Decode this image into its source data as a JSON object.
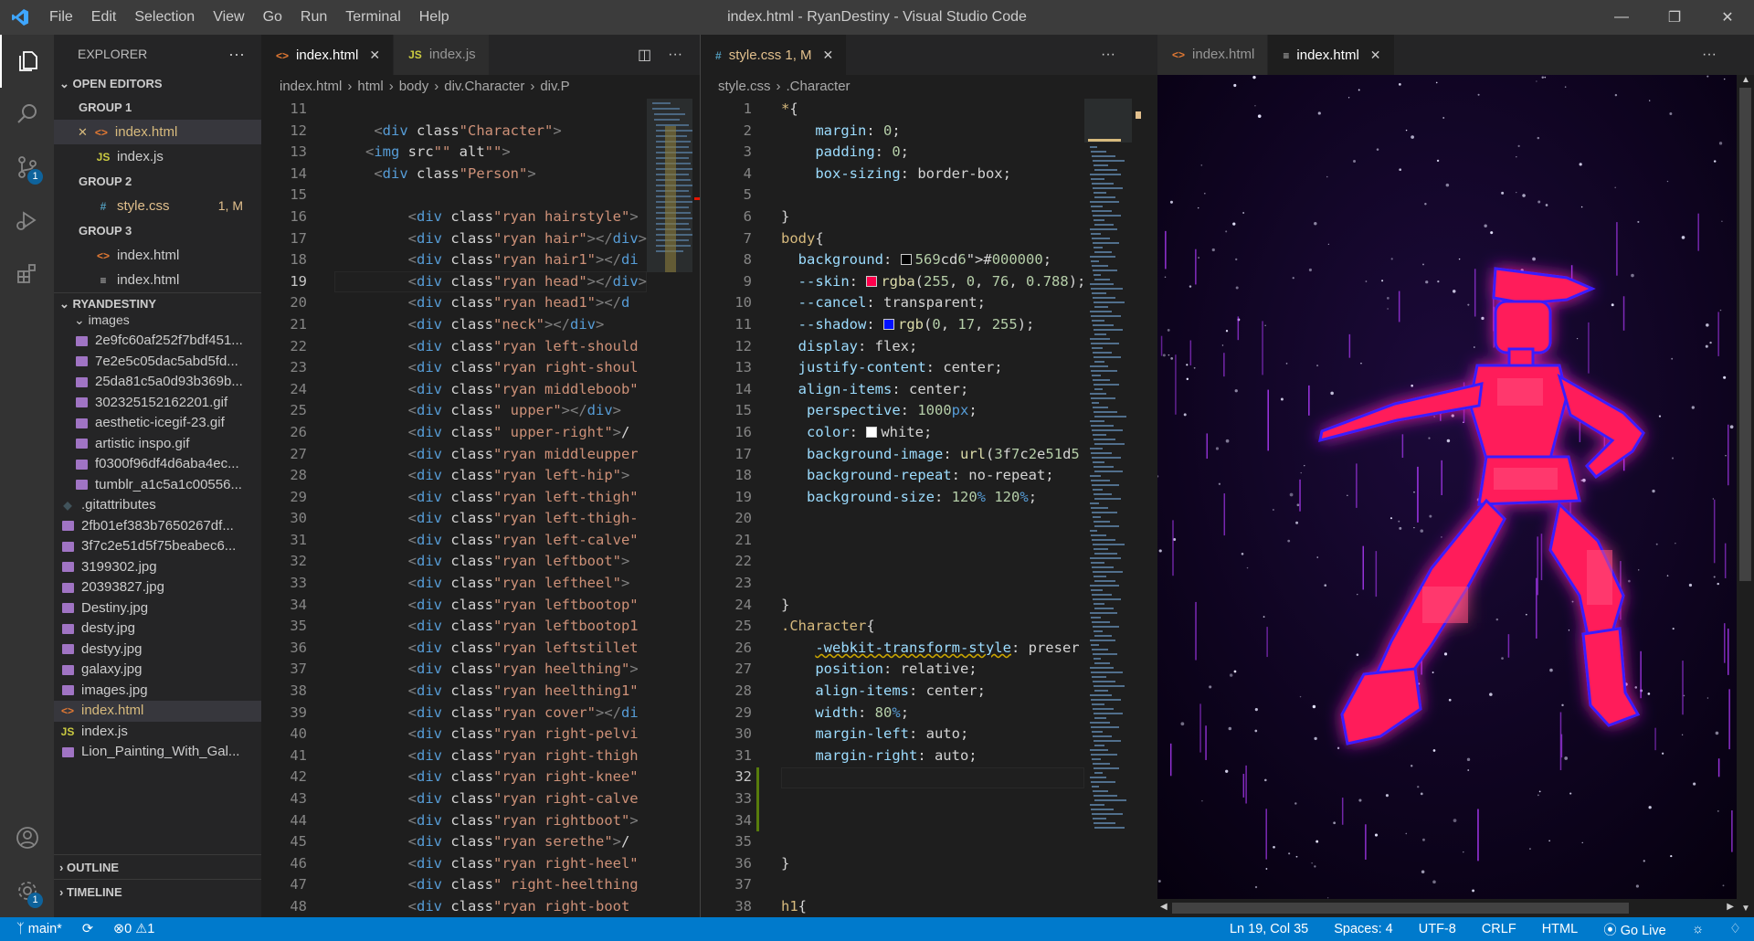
{
  "titlebar": {
    "menu": [
      "File",
      "Edit",
      "Selection",
      "View",
      "Go",
      "Run",
      "Terminal",
      "Help"
    ],
    "title": "index.html - RyanDestiny - Visual Studio Code"
  },
  "sidebar": {
    "title": "EXPLORER",
    "open_editors": "OPEN EDITORS",
    "groups": [
      {
        "name": "GROUP 1",
        "files": [
          {
            "name": "index.html",
            "icon": "<>",
            "selected": true,
            "close": true
          },
          {
            "name": "index.js",
            "icon": "JS"
          }
        ]
      },
      {
        "name": "GROUP 2",
        "files": [
          {
            "name": "style.css",
            "icon": "#",
            "status": "1, M"
          }
        ]
      },
      {
        "name": "GROUP 3",
        "files": [
          {
            "name": "index.html",
            "icon": "<>"
          },
          {
            "name": "index.html",
            "icon": "≡"
          }
        ]
      }
    ],
    "project": "RYANDESTINY",
    "folder": "images",
    "image_files": [
      "2e9fc60af252f7bdf451...",
      "7e2e5c05dac5abd5fd...",
      "25da81c5a0d93b369b...",
      "302325152162201.gif",
      "aesthetic-icegif-23.gif",
      "artistic inspo.gif",
      "f0300f96df4d6aba4ec...",
      "tumblr_a1c5a1c00556..."
    ],
    "root_files": [
      ".gitattributes",
      "2fb01ef383b7650267df...",
      "3f7c2e51d5f75beabec6...",
      "3199302.jpg",
      "20393827.jpg",
      "Destiny.jpg",
      "desty.jpg",
      "destyy.jpg",
      "galaxy.jpg",
      "images.jpg",
      "index.html",
      "index.js",
      "Lion_Painting_With_Gal..."
    ],
    "outline": "OUTLINE",
    "timeline": "TIMELINE"
  },
  "tabs1": [
    {
      "label": "index.html",
      "icon": "<>",
      "active": true
    },
    {
      "label": "index.js",
      "icon": "JS"
    }
  ],
  "tabs2": [
    {
      "label": "style.css 1, M",
      "icon": "#",
      "active": true
    }
  ],
  "tabs3": [
    {
      "label": "index.html",
      "icon": "<>"
    },
    {
      "label": "index.html",
      "icon": "≡",
      "active": true
    }
  ],
  "crumb1": [
    "index.html",
    "html",
    "body",
    "div.Character",
    "div.P"
  ],
  "crumb2": [
    "style.css",
    ".Character"
  ],
  "html_start": 11,
  "html_code": [
    "",
    "    <div class=\"Character\">",
    "   <img src=\"\" alt=\"\">",
    "    <div class=\"Person\">",
    "",
    "        <div class=\"ryan hairstyle\">",
    "        <div class=\"ryan hair\"></div>",
    "        <div class=\"ryan hair1\"></di",
    "        <div class=\"ryan head\"></div>",
    "        <div class=\"ryan head1\"></d",
    "        <div class=\"neck\"></div>",
    "        <div class=\"ryan left-should",
    "        <div class=\"ryan right-shoul",
    "        <div class=\"ryan middleboob\"",
    "        <div class=\" upper\"></div>",
    "        <div class=\" upper-right\"></",
    "        <div class=\"ryan middleupper",
    "        <div class=\"ryan left-hip\">",
    "        <div class=\"ryan left-thigh\"",
    "        <div class=\"ryan left-thigh-",
    "        <div class=\"ryan left-calve\"",
    "        <div class=\"ryan leftboot\">",
    "        <div class=\"ryan leftheel\">",
    "        <div class=\"ryan leftbootop\"",
    "        <div class=\"ryan leftbootop1",
    "        <div class=\"ryan leftstillet",
    "        <div class=\"ryan heelthing\">",
    "        <div class=\"ryan heelthing1\"",
    "        <div class=\"ryan cover\"></di",
    "        <div class=\"ryan right-pelvi",
    "        <div class=\"ryan right-thigh",
    "        <div class=\"ryan right-knee\"",
    "        <div class=\"ryan right-calve",
    "        <div class=\"ryan rightboot\">",
    "        <div class=\"ryan serethe\"></",
    "        <div class=\"ryan right-heel\"",
    "        <div class=\" right-heelthing",
    "        <div class=\"ryan right-boot"
  ],
  "css_start": 1,
  "css_code": [
    "*{",
    "    margin: 0;",
    "    padding: 0;",
    "    box-sizing: border-box;",
    "",
    "}",
    "body{",
    "  background: ■#000000;",
    "  --skin:■rgba(255, 0, 76, 0.788);",
    "  --cancel: transparent;",
    "  --shadow: ■rgb(0, 17, 255);",
    "  display: flex;",
    "  justify-content: center;",
    "  align-items: center;",
    "   perspective: 1000px;",
    "   color: ■white;",
    "   background-image: url(3f7c2e51d5",
    "   background-repeat: no-repeat;",
    "   background-size: 120% 120%;",
    "",
    "",
    "",
    "",
    "}",
    ".Character{",
    "    -webkit-transform-style: preser",
    "    position: relative;",
    "    align-items: center;",
    "    width: 80%;",
    "    margin-left: auto;",
    "    margin-right: auto;",
    "",
    "",
    "",
    "",
    "}",
    "",
    "h1{"
  ],
  "status": {
    "branch": "main*",
    "errors": "0",
    "warnings": "1",
    "position": "Ln 19, Col 35",
    "spaces": "Spaces: 4",
    "encoding": "UTF-8",
    "eol": "CRLF",
    "language": "HTML",
    "golive": "Go Live"
  },
  "colors": {
    "accent": "#007acc",
    "figure": "#ff1e5a",
    "glow": "#3b1fff"
  }
}
